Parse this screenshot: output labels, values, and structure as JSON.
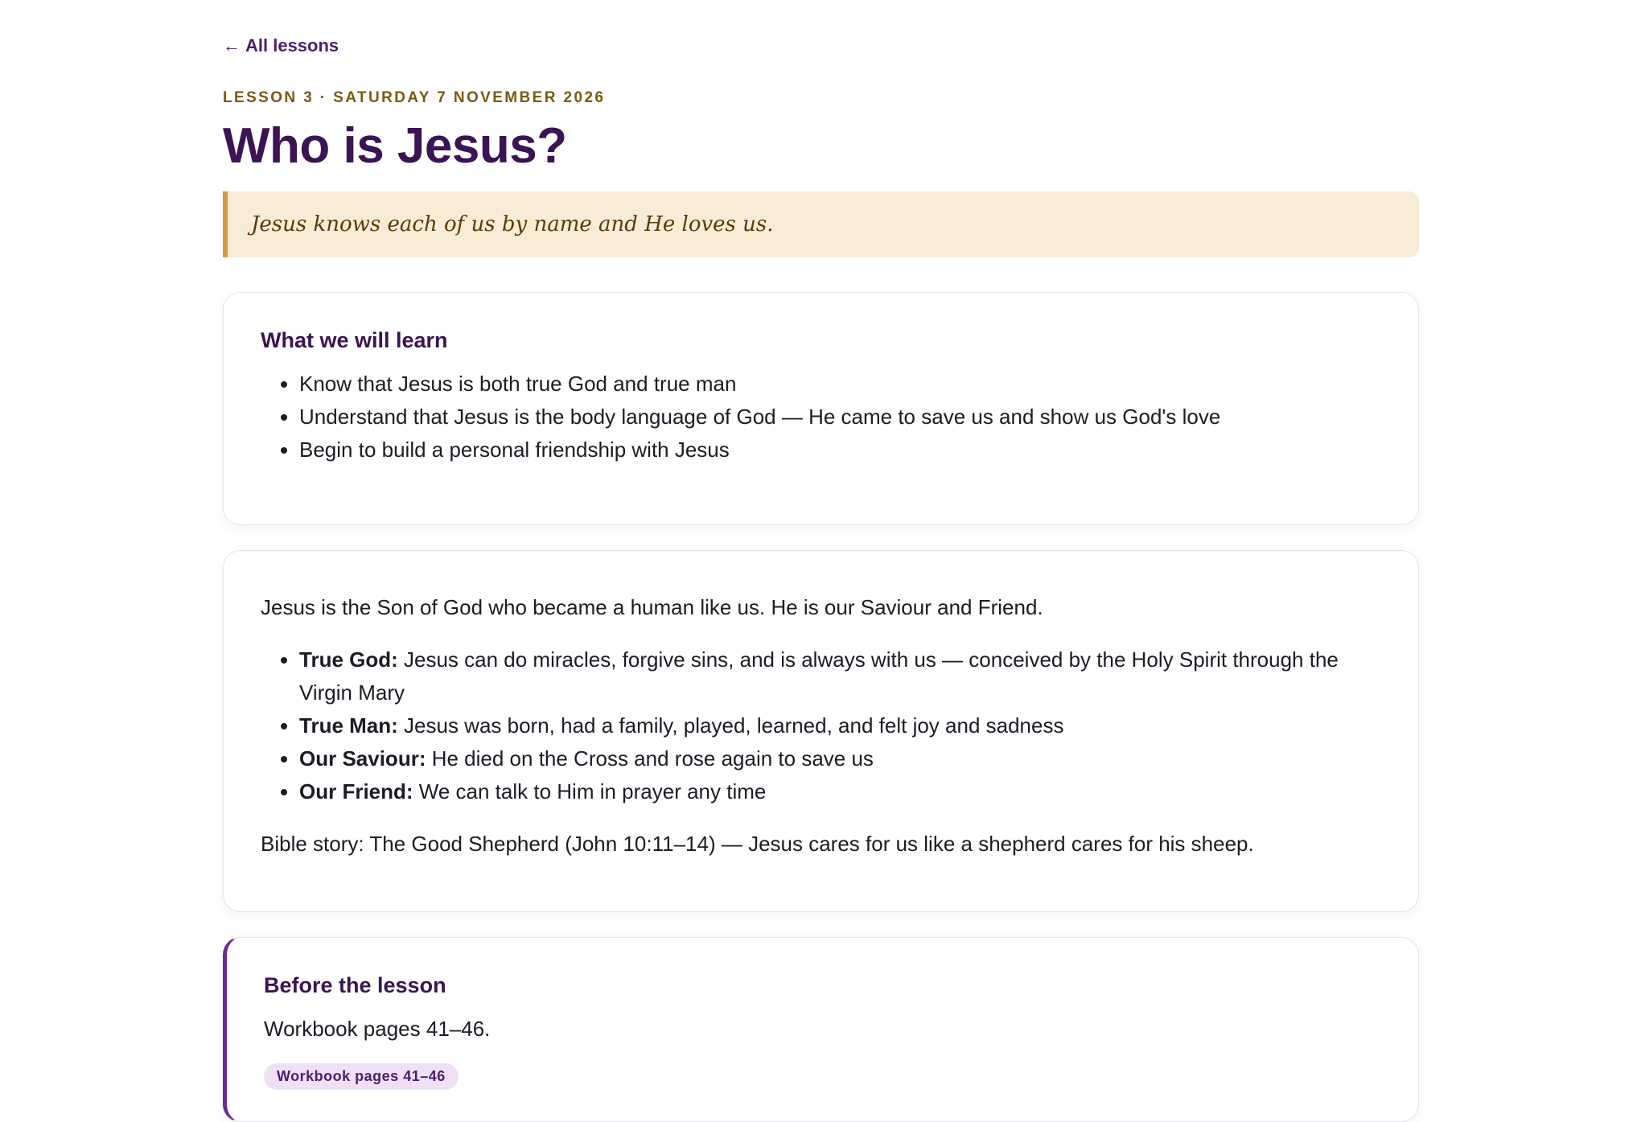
{
  "nav": {
    "back_arrow": "←",
    "back_label": "All lessons"
  },
  "lesson": {
    "eyebrow": "LESSON 3 · SATURDAY 7 NOVEMBER 2026",
    "title": "Who is Jesus?",
    "callout": "Jesus knows each of us by name and He loves us."
  },
  "learn": {
    "heading": "What we will learn",
    "items": [
      "Know that Jesus is both true God and true man",
      "Understand that Jesus is the body language of God — He came to save us and show us God's love",
      "Begin to build a personal friendship with Jesus"
    ]
  },
  "body": {
    "intro": "Jesus is the Son of God who became a human like us. He is our Saviour and Friend.",
    "points": [
      {
        "term": "True God:",
        "text": " Jesus can do miracles, forgive sins, and is always with us — conceived by the Holy Spirit through the Virgin Mary"
      },
      {
        "term": "True Man:",
        "text": " Jesus was born, had a family, played, learned, and felt joy and sadness"
      },
      {
        "term": "Our Saviour:",
        "text": " He died on the Cross and rose again to save us"
      },
      {
        "term": "Our Friend:",
        "text": " We can talk to Him in prayer any time"
      }
    ],
    "story": "Bible story: The Good Shepherd (John 10:11–14) — Jesus cares for us like a shepherd cares for his sheep."
  },
  "before": {
    "heading": "Before the lesson",
    "text": "Workbook pages 41–46.",
    "chip": "Workbook pages 41–46"
  },
  "colors": {
    "brand_purple": "#3a1454",
    "accent_gold": "#d19a3a",
    "callout_bg": "#f8ecd6",
    "chip_bg": "#efe0f6"
  }
}
